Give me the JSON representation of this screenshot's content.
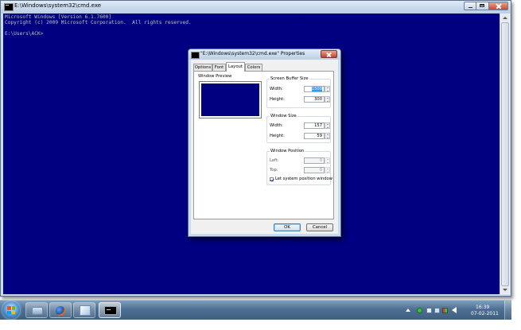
{
  "window": {
    "title": "E:\\Windows\\system32\\cmd.exe"
  },
  "console": {
    "lines": [
      "Microsoft Windows [Version 6.1.7600]",
      "Copyright (c) 2009 Microsoft Corporation.  All rights reserved.",
      "",
      "E:\\Users\\ACK>"
    ],
    "background_color": "#000080",
    "text_color": "#c0c0c0"
  },
  "dialog": {
    "title": "\"E:\\Windows\\system32\\cmd.exe\" Properties",
    "tabs": [
      "Options",
      "Font",
      "Layout",
      "Colors"
    ],
    "active_tab": "Layout",
    "preview": {
      "label": "Window Preview"
    },
    "buffer": {
      "title": "Screen Buffer Size",
      "width_label": "Width:",
      "width_value": "1500",
      "height_label": "Height:",
      "height_value": "300"
    },
    "size": {
      "title": "Window Size",
      "width_label": "Width:",
      "width_value": "157",
      "height_label": "Height:",
      "height_value": "59"
    },
    "position": {
      "title": "Window Position",
      "left_label": "Left:",
      "left_value": "0",
      "top_label": "Top:",
      "top_value": "0",
      "auto_label": "Let system position window",
      "auto_checked": true
    },
    "ok_label": "OK",
    "cancel_label": "Cancel"
  },
  "taskbar": {
    "buttons": [
      "start",
      "explorer-folder",
      "firefox",
      "explorer",
      "cmd"
    ],
    "active": "cmd",
    "clock": {
      "time": "16:39",
      "date": "07-02-2011"
    }
  }
}
